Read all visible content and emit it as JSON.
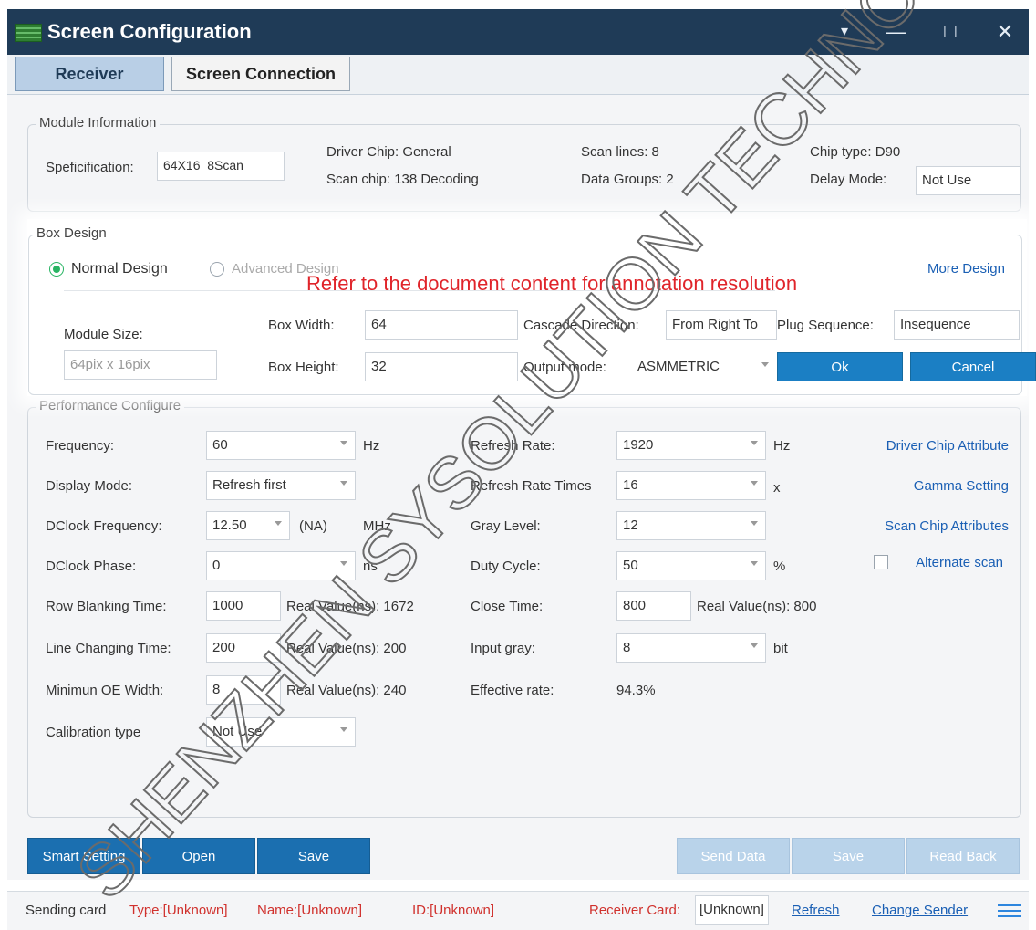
{
  "window": {
    "title": "Screen Configuration",
    "controls": {
      "pin": "▾",
      "minimize": "—",
      "maximize": "☐",
      "close": "✕"
    }
  },
  "tabs": [
    {
      "label": "Receiver",
      "active": true
    },
    {
      "label": "Screen Connection",
      "active": false
    }
  ],
  "module_info": {
    "group_title": "Module Information",
    "spec_label": "Speficification:",
    "spec_value": "64X16_8Scan",
    "driver_chip": "Driver Chip: General",
    "scan_chip": "Scan chip: 138 Decoding",
    "scan_lines": "Scan lines: 8",
    "data_groups": "Data Groups: 2",
    "chip_type": "Chip type: D90",
    "delay_mode_label": "Delay Mode:",
    "delay_mode_value": "Not Use"
  },
  "box_design": {
    "group_title": "Box Design",
    "normal_design": "Normal Design",
    "advanced_design": "Advanced Design",
    "more_design": "More Design",
    "annotation": "Refer to the document content for annotation resolution",
    "module_size_label": "Module Size:",
    "module_size_value": "64pix x 16pix",
    "box_width_label": "Box Width:",
    "box_width_value": "64",
    "box_height_label": "Box Height:",
    "box_height_value": "32",
    "cascade_label": "Cascade Direction:",
    "cascade_value": "From Right To",
    "plug_seq_label": "Plug Sequence:",
    "plug_seq_value": "Insequence",
    "output_mode_label": "Output mode:",
    "output_mode_value": "ASMMETRIC",
    "ok": "Ok",
    "cancel": "Cancel"
  },
  "performance": {
    "group_title": "Performance Configure",
    "frequency_label": "Frequency:",
    "frequency_value": "60",
    "frequency_unit": "Hz",
    "display_mode_label": "Display Mode:",
    "display_mode_value": "Refresh first",
    "dclock_freq_label": "DClock Frequency:",
    "dclock_freq_value": "12.50",
    "dclock_freq_na": "(NA)",
    "dclock_freq_unit": "MHz",
    "dclock_phase_label": "DClock Phase:",
    "dclock_phase_value": "0",
    "dclock_phase_unit": "ns",
    "row_blank_label": "Row Blanking Time:",
    "row_blank_value": "1000",
    "row_blank_real": "Real Value(ns): 1672",
    "line_change_label": "Line Changing Time:",
    "line_change_value": "200",
    "line_change_real": "Real Value(ns): 200",
    "min_oe_label": "Minimun OE Width:",
    "min_oe_value": "8",
    "min_oe_real": "Real Value(ns): 240",
    "calib_label": "Calibration type",
    "calib_value": "Not Use",
    "refresh_rate_label": "Refresh Rate:",
    "refresh_rate_value": "1920",
    "refresh_rate_unit": "Hz",
    "refresh_times_label": "Refresh Rate Times",
    "refresh_times_value": "16",
    "refresh_times_unit": "x",
    "gray_level_label": "Gray Level:",
    "gray_level_value": "12",
    "duty_cycle_label": "Duty Cycle:",
    "duty_cycle_value": "50",
    "duty_cycle_unit": "%",
    "close_time_label": "Close Time:",
    "close_time_value": "800",
    "close_time_real": "Real Value(ns): 800",
    "input_gray_label": "Input gray:",
    "input_gray_value": "8",
    "input_gray_unit": "bit",
    "effective_label": "Effective rate:",
    "effective_value": "94.3%",
    "driver_chip_attr": "Driver Chip Attribute",
    "gamma_setting": "Gamma Setting",
    "scan_chip_attr": "Scan Chip Attributes",
    "alternate_scan": "Alternate scan"
  },
  "bottom_buttons": {
    "smart_setting": "Smart Setting",
    "open": "Open",
    "save": "Save",
    "send_data": "Send Data",
    "save2": "Save",
    "read_back": "Read Back"
  },
  "status": {
    "sending_card": "Sending card",
    "type": "Type:[Unknown]",
    "name": "Name:[Unknown]",
    "id": "ID:[Unknown]",
    "receiver_card_label": "Receiver Card:",
    "receiver_card_value": "[Unknown]",
    "refresh": "Refresh",
    "change_sender": "Change Sender"
  },
  "watermark": "SHENZHEN SYSOLUTION TECHNOLOGY CO.",
  "colors": {
    "titlebar": "#1f3b57",
    "accent_blue": "#1b7fc4",
    "link_blue": "#1a5fb4",
    "status_red": "#d0312d",
    "radio_green": "#28b463"
  }
}
